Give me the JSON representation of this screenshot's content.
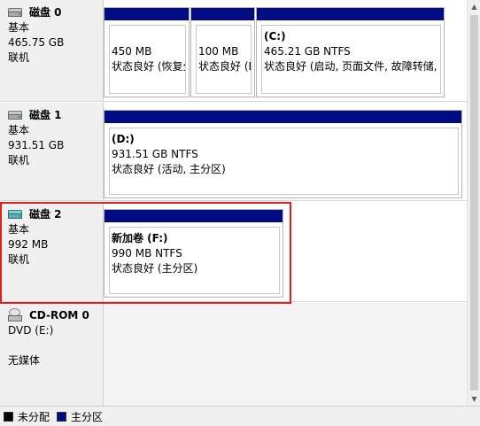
{
  "disks": [
    {
      "name": "磁盘 0",
      "type": "基本",
      "size": "465.75 GB",
      "status": "联机",
      "icon": "hdd-icon",
      "partitions": [
        {
          "title": "",
          "size": "450 MB",
          "status": "状态良好 (恢复分区)"
        },
        {
          "title": "",
          "size": "100 MB",
          "status": "状态良好 (EFI 系统分区)"
        },
        {
          "title": "(C:)",
          "size": "465.21 GB NTFS",
          "status": "状态良好 (启动, 页面文件, 故障转储, 主分区)"
        }
      ]
    },
    {
      "name": "磁盘 1",
      "type": "基本",
      "size": "931.51 GB",
      "status": "联机",
      "icon": "hdd-icon",
      "partitions": [
        {
          "title": "(D:)",
          "size": "931.51 GB NTFS",
          "status": "状态良好 (活动, 主分区)"
        }
      ]
    },
    {
      "name": "磁盘 2",
      "type": "基本",
      "size": "992 MB",
      "status": "联机",
      "icon": "usb-drive-icon",
      "partitions": [
        {
          "title": "新加卷  (F:)",
          "size": "990 MB NTFS",
          "status": "状态良好 (主分区)"
        }
      ]
    },
    {
      "name": "CD-ROM 0",
      "type": "DVD (E:)",
      "size": "",
      "status": "无媒体",
      "icon": "cd-drive-icon",
      "partitions": []
    }
  ],
  "legend": [
    {
      "label": "未分配",
      "color": "#000000"
    },
    {
      "label": "主分区",
      "color": "#000b84"
    }
  ],
  "colors": {
    "primary_partition_bar": "#000b84",
    "selection_highlight": "#e0201a"
  }
}
